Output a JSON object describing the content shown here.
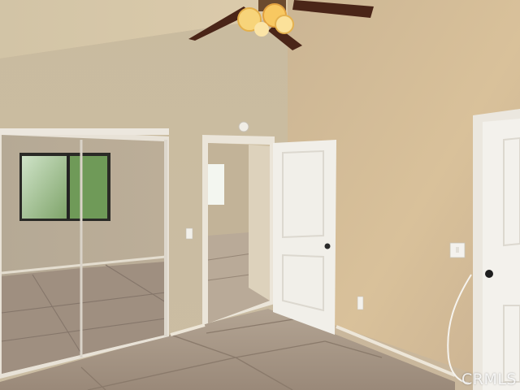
{
  "photo": {
    "subject": "empty-bedroom-interior",
    "watermark_text": "CRMLS"
  },
  "colors": {
    "wall_left": "#cdbd9f",
    "wall_right": "#d7bf98",
    "ceiling": "#d8c9ab",
    "floor": "#a29282",
    "door": "#f1efe9",
    "trim": "#ece6da"
  }
}
